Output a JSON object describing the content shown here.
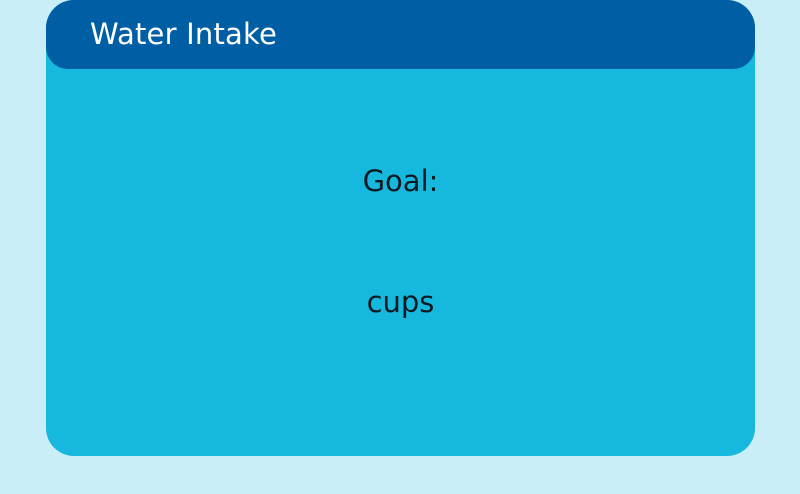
{
  "header": {
    "title": "Water Intake"
  },
  "main": {
    "goal_label": "Goal:",
    "unit_label": "cups"
  },
  "colors": {
    "page_background": "#c9eef8",
    "card_background": "#17b8dd",
    "header_background": "#005ea5",
    "header_text": "#ffffff",
    "body_text": "#0a1a22"
  }
}
